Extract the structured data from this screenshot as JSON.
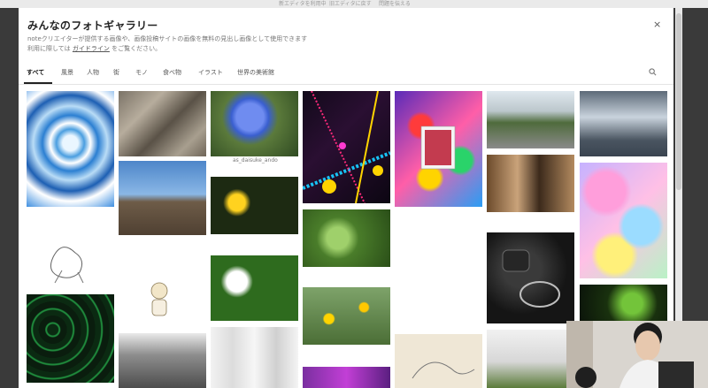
{
  "topbar": {
    "text1": "新エディタを利用中",
    "text2": "旧エディタに戻す",
    "text3": "問題を伝える"
  },
  "modal": {
    "title": "みんなのフォトギャラリー",
    "desc_line1": "noteクリエイターが提供する画像や、画像投稿サイトの画像を無料の見出し画像として使用できます",
    "desc_line2_prefix": "利用に際しては",
    "desc_link": "ガイドライン",
    "desc_line2_suffix": "をご覧ください。",
    "close_label": "×"
  },
  "tabs": [
    {
      "label": "すべて"
    },
    {
      "label": "風景"
    },
    {
      "label": "人物"
    },
    {
      "label": "街"
    },
    {
      "label": "モノ"
    },
    {
      "label": "食べ物"
    },
    {
      "label": "イラスト"
    },
    {
      "label": "世界の美術館"
    }
  ],
  "photo_caption": "as_daisuke_ando",
  "colors": {
    "accent": "#222222",
    "modal_bg": "#ffffff",
    "overlay_bg": "#3a3a3a"
  },
  "icons": {
    "search": "search-icon",
    "close": "close-icon"
  }
}
